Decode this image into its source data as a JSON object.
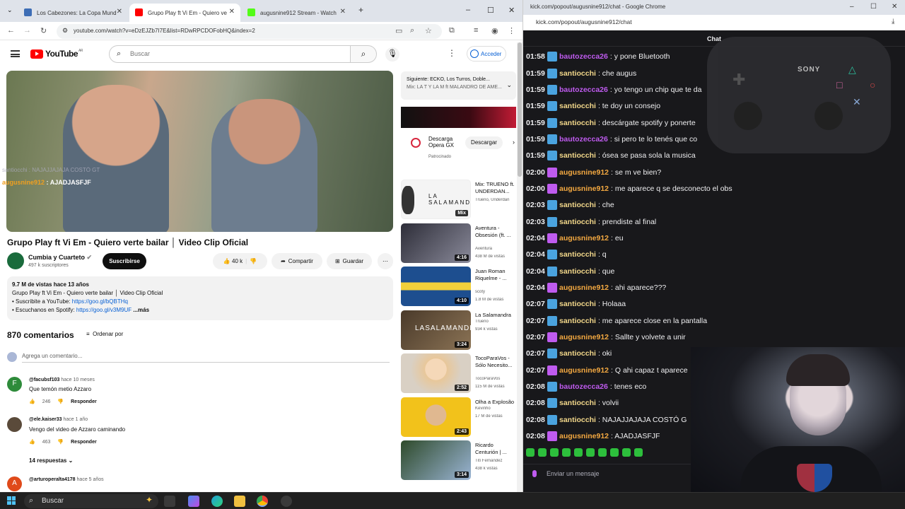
{
  "left_browser": {
    "tabs": [
      {
        "label": "Los Cabezones: La Copa Mund",
        "active": false,
        "fav_color": "#3d6db5"
      },
      {
        "label": "Grupo Play ft Vi Em - Quiero ve",
        "active": true,
        "fav_color": "#ff0000"
      },
      {
        "label": "augusnine912 Stream - Watch",
        "active": false,
        "fav_color": "#53fc18"
      }
    ],
    "url": "youtube.com/watch?v=eDzEJZb7I7E&list=RDwRPCDOFobHQ&index=2"
  },
  "youtube": {
    "logo_text": "YouTube",
    "logo_region": "AR",
    "search_placeholder": "Buscar",
    "login_label": "Acceder",
    "video": {
      "overlay_line1": "santiocchi : NAJAJJAJAJA COSTÓ GT",
      "overlay_user": "augusnine912",
      "overlay_msg": ": AJADJASFJF",
      "title": "Grupo Play ft Vi Em - Quiero verte bailar │ Video Clip Oficial",
      "channel": "Cumbia y Cuarteto",
      "subscribers": "497 k suscriptores",
      "subscribe_label": "Suscribirse",
      "likes": "40 k",
      "share_label": "Compartir",
      "save_label": "Guardar"
    },
    "description": {
      "stats": "9.7 M de vistas  hace 13 años",
      "line1": "Grupo Play ft Vi Em - Quiero verte bailar │ Video Clip Oficial",
      "line2_prefix": "• Suscribite a YouTube: ",
      "line2_link": "https://goo.gl/bQBTHq",
      "line3_prefix": "• Escuchanos en Spotify: ",
      "line3_link": "https://goo.gl/v3M9UF",
      "more": "...más"
    },
    "comments_header": {
      "count": "870 comentarios",
      "sort_label": "Ordenar por"
    },
    "add_comment_placeholder": "Agrega un comentario...",
    "comments": [
      {
        "user": "@facubsf103",
        "time": "hace 10 meses",
        "text": "Que temón metio Azzaro",
        "likes": "246",
        "reply": "Responder",
        "avatar_color": "#2e8b3a",
        "avatar_letter": "F"
      },
      {
        "user": "@ele.kaiser33",
        "time": "hace 1 año",
        "text": "Vengo del video de Azzaro caminando",
        "likes": "463",
        "reply": "Responder",
        "avatar_color": "#5a4a3a",
        "avatar_letter": ""
      },
      {
        "user": "@arturoperalta4178",
        "time": "hace 5 años",
        "text": "",
        "likes": "",
        "reply": "",
        "avatar_color": "#e04a1a",
        "avatar_letter": "A"
      }
    ],
    "replies_label": "14 respuestas",
    "sidebar": {
      "next_label": "Siguiente: ECKO, Los Turros, Doble...",
      "next_sub": "Mix: LA T Y LA M ft MALANDRO DE AME...",
      "ad": {
        "title_line1": "Descarga",
        "title_line2": "Opera GX",
        "sponsored": "Patrocinado",
        "button": "Descargar"
      },
      "videos": [
        {
          "title": "Mix: TRUENO ft. UNDERDAN...",
          "channel": "Trueno, Underdan",
          "views": "",
          "duration": "Mix",
          "thumb": "#f4f4f4"
        },
        {
          "title": "Aventura - Obsesión (ft. ...",
          "channel": "Aventura",
          "views": "438 M de vistas",
          "duration": "4:16",
          "thumb": "#3a3a48"
        },
        {
          "title": "Juan Roman Riquelme - ...",
          "channel": "scoty",
          "views": "1.8 M de vistas",
          "duration": "4:10",
          "thumb": "#1d4e8f"
        },
        {
          "title": "La Salamandra",
          "channel": "Trueno",
          "views": "934 k vistas",
          "duration": "3:24",
          "thumb": "#6b5440"
        },
        {
          "title": "TocoParaVos - Sólo Necesito...",
          "channel": "TocoParaVos",
          "views": "115 M de vistas",
          "duration": "2:52",
          "thumb": "#d8b48c"
        },
        {
          "title": "Olha a Explosão",
          "channel": "Kevinho",
          "views": "17 M de vistas",
          "duration": "2:43",
          "thumb": "#f2c21b"
        },
        {
          "title": "Ricardo Centurión | ...",
          "channel": "Tití Fernández",
          "views": "438 k vistas",
          "duration": "3:14",
          "thumb": "#4c6b3c"
        }
      ]
    }
  },
  "right_window": {
    "title": "kick.com/popout/augusnine912/chat - Google Chrome",
    "url": "kick.com/popout/augusnine912/chat",
    "chat_header": "Chat",
    "controller_brand": "SONY",
    "input_placeholder": "Enviar un mensaje",
    "messages": [
      {
        "time": "01:58",
        "user": "bautozecca26",
        "text": ": y pone Bluetooth",
        "color": "#bf5bef",
        "badge": "#4aa3df"
      },
      {
        "time": "01:59",
        "user": "santiocchi",
        "text": ": che augus",
        "color": "#f2d78a",
        "badge": "#4aa3df"
      },
      {
        "time": "01:59",
        "user": "bautozecca26",
        "text": ": yo tengo un chip que te da",
        "color": "#bf5bef",
        "badge": "#4aa3df"
      },
      {
        "time": "01:59",
        "user": "santiocchi",
        "text": ": te doy un consejo",
        "color": "#f2d78a",
        "badge": "#4aa3df"
      },
      {
        "time": "01:59",
        "user": "santiocchi",
        "text": ": descárgate spotify y ponerte",
        "color": "#f2d78a",
        "badge": "#4aa3df"
      },
      {
        "time": "01:59",
        "user": "bautozecca26",
        "text": ": si pero te lo tenés que co",
        "color": "#bf5bef",
        "badge": "#4aa3df"
      },
      {
        "time": "01:59",
        "user": "santiocchi",
        "text": ": ósea se pasa sola la musica",
        "color": "#f2d78a",
        "badge": "#4aa3df"
      },
      {
        "time": "02:00",
        "user": "augusnine912",
        "text": ": se m ve bien?",
        "color": "#f4a941",
        "badge": "#bf5bef"
      },
      {
        "time": "02:00",
        "user": "augusnine912",
        "text": ": me aparece q se desconecto el obs",
        "color": "#f4a941",
        "badge": "#bf5bef"
      },
      {
        "time": "02:03",
        "user": "santiocchi",
        "text": ": che",
        "color": "#f2d78a",
        "badge": "#4aa3df"
      },
      {
        "time": "02:03",
        "user": "santiocchi",
        "text": ": prendiste al final",
        "color": "#f2d78a",
        "badge": "#4aa3df"
      },
      {
        "time": "02:04",
        "user": "augusnine912",
        "text": ": eu",
        "color": "#f4a941",
        "badge": "#bf5bef"
      },
      {
        "time": "02:04",
        "user": "santiocchi",
        "text": ": q",
        "color": "#f2d78a",
        "badge": "#4aa3df"
      },
      {
        "time": "02:04",
        "user": "santiocchi",
        "text": ": que",
        "color": "#f2d78a",
        "badge": "#4aa3df"
      },
      {
        "time": "02:04",
        "user": "augusnine912",
        "text": ": ahi aparece???",
        "color": "#f4a941",
        "badge": "#bf5bef"
      },
      {
        "time": "02:07",
        "user": "santiocchi",
        "text": ": Holaaa",
        "color": "#f2d78a",
        "badge": "#4aa3df"
      },
      {
        "time": "02:07",
        "user": "santiocchi",
        "text": ": me aparece close en la pantalla",
        "color": "#f2d78a",
        "badge": "#4aa3df"
      },
      {
        "time": "02:07",
        "user": "augusnine912",
        "text": ": Sallte y volvete a unir",
        "color": "#f4a941",
        "badge": "#bf5bef"
      },
      {
        "time": "02:07",
        "user": "santiocchi",
        "text": ": oki",
        "color": "#f2d78a",
        "badge": "#4aa3df"
      },
      {
        "time": "02:07",
        "user": "augusnine912",
        "text": ": Q ahi capaz t aparece",
        "color": "#f4a941",
        "badge": "#bf5bef"
      },
      {
        "time": "02:08",
        "user": "bautozecca26",
        "text": ": tenes eco",
        "color": "#bf5bef",
        "badge": "#4aa3df"
      },
      {
        "time": "02:08",
        "user": "santiocchi",
        "text": ": volvii",
        "color": "#f2d78a",
        "badge": "#4aa3df"
      },
      {
        "time": "02:08",
        "user": "santiocchi",
        "text": ": NAJAJJAJAJA COSTÓ G",
        "color": "#f2d78a",
        "badge": "#4aa3df"
      },
      {
        "time": "02:08",
        "user": "augusnine912",
        "text": ": AJADJASFJF",
        "color": "#f4a941",
        "badge": "#bf5bef"
      }
    ]
  },
  "taskbar": {
    "search_label": "Buscar"
  }
}
